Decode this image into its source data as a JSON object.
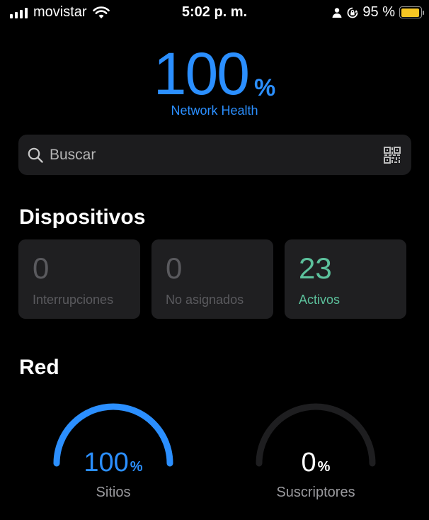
{
  "status_bar": {
    "carrier": "movistar",
    "time": "5:02 p. m.",
    "battery_pct": "95 %",
    "battery_level": 0.95,
    "icons": [
      "cellular-signal-icon",
      "wifi-icon",
      "person-icon",
      "orientation-lock-icon",
      "battery-icon"
    ],
    "battery_color": "#f7c623"
  },
  "health": {
    "value": "100",
    "unit": "%",
    "label": "Network Health",
    "color": "#2b8fff"
  },
  "search": {
    "placeholder": "Buscar",
    "value": "",
    "icons": [
      "search-icon",
      "qr-code-icon"
    ]
  },
  "devices": {
    "title": "Dispositivos",
    "cards": [
      {
        "value": "0",
        "label": "Interrupciones",
        "color": "#5a5a5e"
      },
      {
        "value": "0",
        "label": "No asignados",
        "color": "#5a5a5e"
      },
      {
        "value": "23",
        "label": "Activos",
        "color": "#5cc19c"
      }
    ]
  },
  "network": {
    "title": "Red",
    "gauges": [
      {
        "value": "100",
        "unit": "%",
        "label": "Sitios",
        "fraction": 1.0,
        "color": "#2b8fff",
        "value_color": "#2b8fff"
      },
      {
        "value": "0",
        "unit": "%",
        "label": "Suscriptores",
        "fraction": 0.0,
        "color": "#2b8fff",
        "value_color": "#ffffff"
      }
    ]
  }
}
